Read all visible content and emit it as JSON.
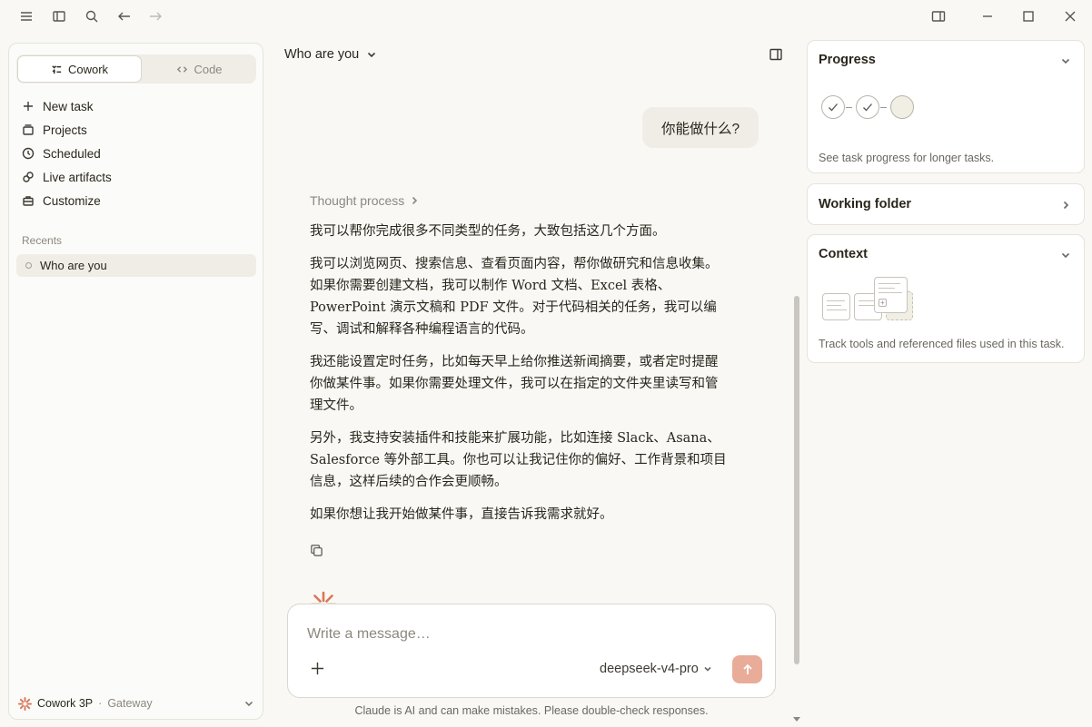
{
  "window": {
    "icons": [
      "menu-icon",
      "sidebar-toggle-icon",
      "search-icon",
      "back-arrow-icon",
      "forward-arrow-icon",
      "split-view-icon",
      "minimize-icon",
      "maximize-icon",
      "close-icon"
    ]
  },
  "sidebar": {
    "modes": [
      {
        "label": "Cowork",
        "active": true
      },
      {
        "label": "Code",
        "active": false
      }
    ],
    "nav": [
      {
        "label": "New task",
        "icon": "plus-icon"
      },
      {
        "label": "Projects",
        "icon": "projects-icon"
      },
      {
        "label": "Scheduled",
        "icon": "clock-icon"
      },
      {
        "label": "Live artifacts",
        "icon": "artifacts-icon"
      },
      {
        "label": "Customize",
        "icon": "briefcase-icon"
      }
    ],
    "recents_label": "Recents",
    "recents": [
      {
        "label": "Who are you"
      }
    ],
    "footer": {
      "product": "Cowork 3P",
      "separator": "·",
      "gateway": "Gateway"
    }
  },
  "chat": {
    "title": "Who are you",
    "user_message": "你能做什么?",
    "thought_label": "Thought process",
    "reply_paragraphs": [
      "我可以帮你完成很多不同类型的任务，大致包括这几个方面。",
      "我可以浏览网页、搜索信息、查看页面内容，帮你做研究和信息收集。如果你需要创建文档，我可以制作 Word 文档、Excel 表格、PowerPoint 演示文稿和 PDF 文件。对于代码相关的任务，我可以编写、调试和解释各种编程语言的代码。",
      "我还能设置定时任务，比如每天早上给你推送新闻摘要，或者定时提醒你做某件事。如果你需要处理文件，我可以在指定的文件夹里读写和管理文件。",
      "另外，我支持安装插件和技能来扩展功能，比如连接 Slack、Asana、Salesforce 等外部工具。你也可以让我记住你的偏好、工作背景和项目信息，这样后续的合作会更顺畅。",
      "如果你想让我开始做某件事，直接告诉我需求就好。"
    ],
    "composer": {
      "placeholder": "Write a message…",
      "model": "deepseek-v4-pro"
    },
    "disclaimer": "Claude is AI and can make mistakes. Please double-check responses."
  },
  "right_panel": {
    "progress": {
      "title": "Progress",
      "caption": "See task progress for longer tasks.",
      "steps_done": 2,
      "steps_total": 3
    },
    "working_folder": {
      "title": "Working folder"
    },
    "context": {
      "title": "Context",
      "caption": "Track tools and referenced files used in this task."
    }
  },
  "colors": {
    "accent": "#d97757",
    "send_button": "#e8ac98",
    "background": "#f9f8f5"
  }
}
